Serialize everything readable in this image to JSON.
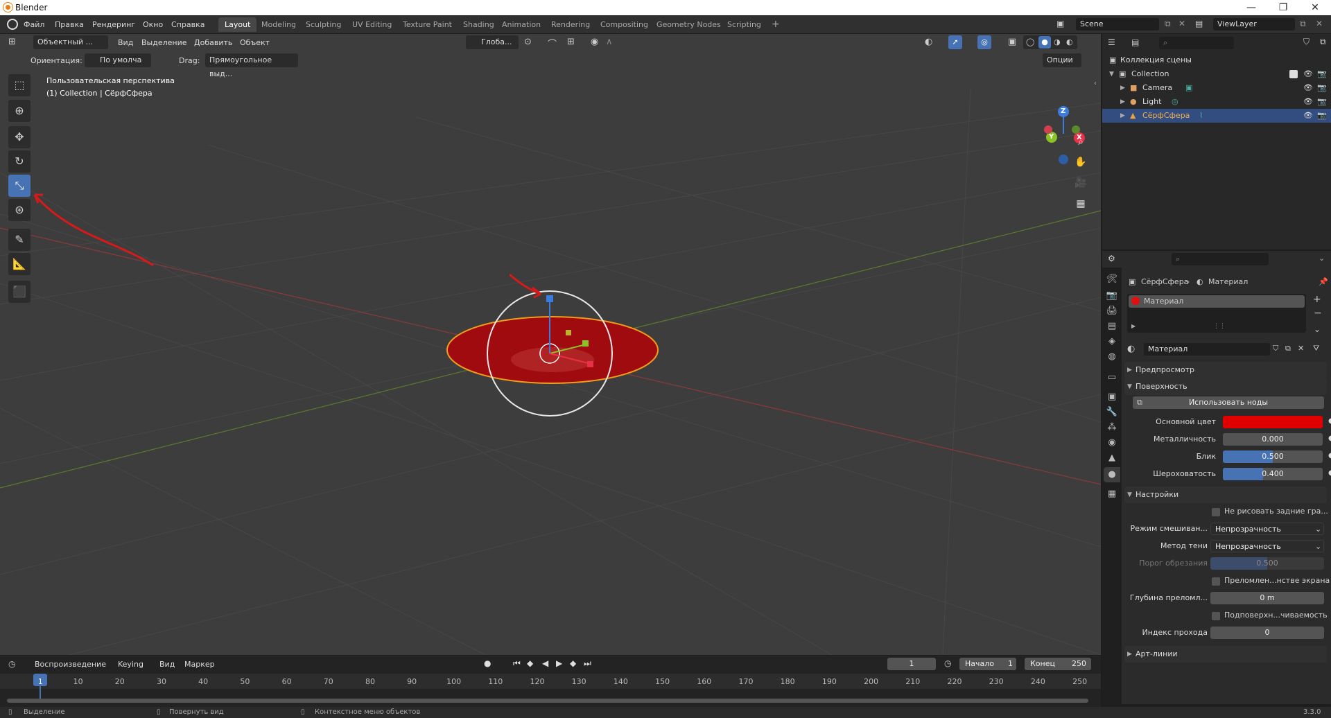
{
  "window": {
    "title": "Blender",
    "minimize": "—",
    "maximize": "❐",
    "close": "✕"
  },
  "menu": [
    "Файл",
    "Правка",
    "Рендеринг",
    "Окно",
    "Справка"
  ],
  "workspaces": [
    "Layout",
    "Modeling",
    "Sculpting",
    "UV Editing",
    "Texture Paint",
    "Shading",
    "Animation",
    "Rendering",
    "Compositing",
    "Geometry Nodes",
    "Scripting"
  ],
  "active_workspace": "Layout",
  "add_workspace": "+",
  "scene": {
    "name": "Scene",
    "view_layer": "ViewLayer"
  },
  "viewport": {
    "mode": "Объектный ...",
    "menus": [
      "Вид",
      "Выделение",
      "Добавить",
      "Объект"
    ],
    "transform_orientation": "Глоба...",
    "orientation_label": "Ориентация:",
    "orientation_value": "По умолча",
    "drag_label": "Drag:",
    "drag_value": "Прямоугольное выд...",
    "options": "Опции",
    "view_name": "Пользовательская перспектива",
    "view_object": "(1) Collection | СёрфСфера",
    "gizmo": {
      "z": "Z",
      "y": "Y",
      "x": "X"
    }
  },
  "outliner": {
    "scene_collection": "Коллекция сцены",
    "collection": "Collection",
    "items": [
      {
        "name": "Camera",
        "selected": false,
        "color": "#e0a060"
      },
      {
        "name": "Light",
        "selected": false,
        "color": "#e0a060"
      },
      {
        "name": "СёрфСфера",
        "selected": true,
        "color": "#e8a040"
      }
    ]
  },
  "properties": {
    "breadcrumb_object": "СёрфСфера",
    "breadcrumb_material": "Материал",
    "slot_name": "Материал",
    "material_name": "Материал",
    "panels": {
      "preview": "Предпросмотр",
      "surface": "Поверхность",
      "settings": "Настройки",
      "lineart": "Арт-линии"
    },
    "use_nodes": "Использовать ноды",
    "base_color_label": "Основной цвет",
    "base_color": "#e00000",
    "metallic_label": "Металличность",
    "metallic": "0.000",
    "metallic_fraction": 0,
    "specular_label": "Блик",
    "specular": "0.500",
    "specular_fraction": 0.5,
    "roughness_label": "Шероховатость",
    "roughness": "0.400",
    "roughness_fraction": 0.4,
    "backface_label": "Не рисовать задние гра...",
    "blend_mode_label": "Режим смешиван...",
    "blend_mode": "Непрозрачность",
    "shadow_label": "Метод тени",
    "shadow_mode": "Непрозрачность",
    "clip_label": "Порог обрезания",
    "clip": "0.500",
    "clip_fraction": 0.5,
    "refraction_label": "Преломлен...нстве экрана",
    "refr_depth_label": "Глубина преломл...",
    "refr_depth": "0 m",
    "sss_label": "Подповерхн...чиваемость",
    "pass_index_label": "Индекс прохода",
    "pass_index": "0"
  },
  "timeline": {
    "menus": [
      "Воспроизведение",
      "Keying",
      "Вид",
      "Маркер"
    ],
    "current_frame": "1",
    "start_label": "Начало",
    "start": "1",
    "end_label": "Конец",
    "end": "250",
    "ticks": [
      "1",
      "10",
      "20",
      "30",
      "40",
      "50",
      "60",
      "70",
      "80",
      "90",
      "100",
      "110",
      "120",
      "130",
      "140",
      "150",
      "160",
      "170",
      "180",
      "190",
      "200",
      "210",
      "220",
      "230",
      "240",
      "250"
    ]
  },
  "status": {
    "left": "Выделение",
    "middle": "Повернуть вид",
    "right": "Контекстное меню объектов",
    "version": "3.3.0"
  }
}
